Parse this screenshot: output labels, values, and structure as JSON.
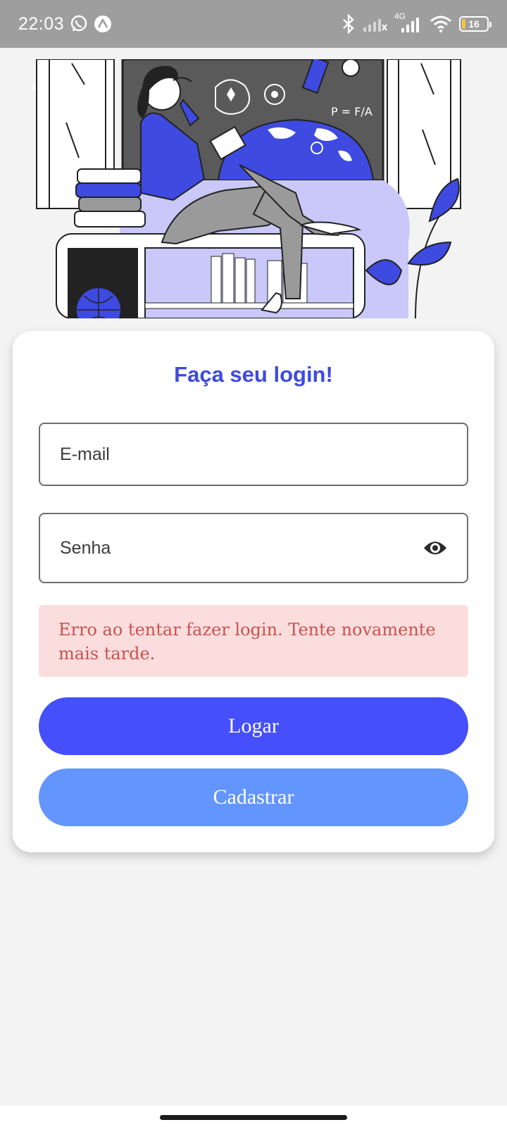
{
  "status_bar": {
    "time": "22:03",
    "left_icons": [
      "whatsapp-icon",
      "expo-icon"
    ],
    "right_icons": [
      "bluetooth-icon",
      "signal-icon",
      "signal-4g-icon",
      "wifi-icon"
    ],
    "network_label": "4G",
    "battery_level": "16"
  },
  "hero": {
    "illustration": "woman-reading-on-window-seat-illustration",
    "board_formula": "P = F/A"
  },
  "login": {
    "title": "Faça seu login!",
    "email_placeholder": "E-mail",
    "password_placeholder": "Senha",
    "error_message": "Erro ao tentar fazer login. Tente novamente mais tarde.",
    "login_button": "Logar",
    "register_button": "Cadastrar"
  },
  "colors": {
    "accent": "#454ffb",
    "secondary": "#6395ff",
    "title": "#3e4ae0",
    "error_bg": "#fcdddd",
    "error_text": "#c9524f"
  }
}
